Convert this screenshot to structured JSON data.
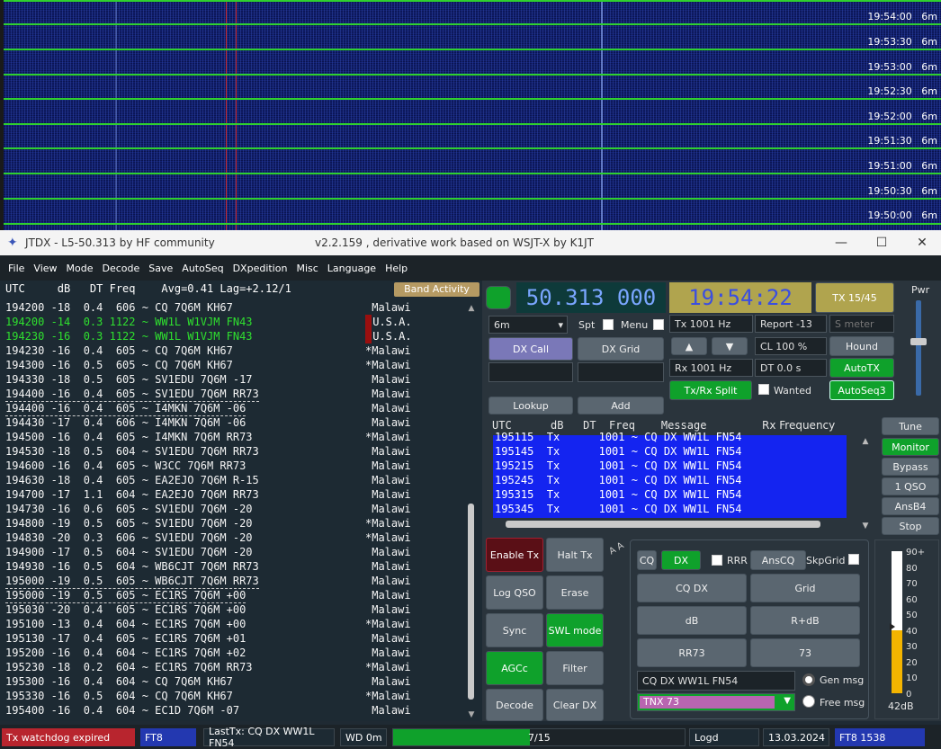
{
  "waterfall": {
    "times": [
      "19:54:00",
      "19:53:30",
      "19:53:00",
      "19:52:30",
      "19:52:00",
      "19:51:30",
      "19:51:00",
      "19:50:30",
      "19:50:00"
    ],
    "band": "6m"
  },
  "titlebar": {
    "title": "JTDX - L5-50.313  by HF community",
    "subtitle": "v2.2.159 , derivative work based on WSJT-X by K1JT",
    "minimize": "—",
    "maximize": "☐",
    "close": "✕"
  },
  "menu": [
    "File",
    "View",
    "Mode",
    "Decode",
    "Save",
    "AutoSeq",
    "DXpedition",
    "Misc",
    "Language",
    "Help"
  ],
  "decode_header": "UTC     dB   DT Freq    Avg=0.41 Lag=+2.12/1",
  "band_activity": "Band Activity",
  "decodes": [
    {
      "msg": "194200 -18  0.4  606 ~ CQ 7Q6M KH67",
      "country": " Malawi",
      "style": "white"
    },
    {
      "msg": "194200 -14  0.3 1122 ~ WW1L W1VJM FN43",
      "country": " U.S.A.",
      "style": "green"
    },
    {
      "msg": "194230 -16  0.3 1122 ~ WW1L W1VJM FN43",
      "country": " U.S.A.",
      "style": "green"
    },
    {
      "msg": "194230 -16  0.4  605 ~ CQ 7Q6M KH67",
      "country": "*Malawi",
      "style": "white"
    },
    {
      "msg": "194300 -16  0.5  605 ~ CQ 7Q6M KH67",
      "country": "*Malawi",
      "style": "white"
    },
    {
      "msg": "194330 -18  0.5  605 ~ SV1EDU 7Q6M -17",
      "country": " Malawi",
      "style": "white"
    },
    {
      "msg": "194400 -16  0.4  605 ~ SV1EDU 7Q6M RR73",
      "country": " Malawi",
      "style": "white"
    },
    {
      "msg": "194400 -16  0.4  605 ~ I4MKN 7Q6M -06",
      "country": " Malawi",
      "style": "white"
    },
    {
      "msg": "194430 -17  0.4  606 ~ I4MKN 7Q6M -06",
      "country": " Malawi",
      "style": "white"
    },
    {
      "msg": "194500 -16  0.4  605 ~ I4MKN 7Q6M RR73",
      "country": "*Malawi",
      "style": "white"
    },
    {
      "msg": "194530 -18  0.5  604 ~ SV1EDU 7Q6M RR73",
      "country": " Malawi",
      "style": "white"
    },
    {
      "msg": "194600 -16  0.4  605 ~ W3CC 7Q6M RR73",
      "country": " Malawi",
      "style": "white"
    },
    {
      "msg": "194630 -18  0.4  605 ~ EA2EJO 7Q6M R-15",
      "country": " Malawi",
      "style": "white"
    },
    {
      "msg": "194700 -17  1.1  604 ~ EA2EJO 7Q6M RR73",
      "country": " Malawi",
      "style": "white"
    },
    {
      "msg": "194730 -16  0.6  605 ~ SV1EDU 7Q6M -20",
      "country": " Malawi",
      "style": "white"
    },
    {
      "msg": "194800 -19  0.5  605 ~ SV1EDU 7Q6M -20",
      "country": "*Malawi",
      "style": "white"
    },
    {
      "msg": "194830 -20  0.3  606 ~ SV1EDU 7Q6M -20",
      "country": "*Malawi",
      "style": "white"
    },
    {
      "msg": "194900 -17  0.5  604 ~ SV1EDU 7Q6M -20",
      "country": " Malawi",
      "style": "white"
    },
    {
      "msg": "194930 -16  0.5  604 ~ WB6CJT 7Q6M RR73",
      "country": " Malawi",
      "style": "white"
    },
    {
      "msg": "195000 -19  0.5  605 ~ WB6CJT 7Q6M RR73",
      "country": " Malawi",
      "style": "white"
    },
    {
      "msg": "195000 -19  0.5  605 ~ EC1RS 7Q6M +00",
      "country": " Malawi",
      "style": "white"
    },
    {
      "msg": "195030 -20  0.4  605 ~ EC1RS 7Q6M +00",
      "country": " Malawi",
      "style": "white"
    },
    {
      "msg": "195100 -13  0.4  604 ~ EC1RS 7Q6M +00",
      "country": "*Malawi",
      "style": "white"
    },
    {
      "msg": "195130 -17  0.4  605 ~ EC1RS 7Q6M +01",
      "country": " Malawi",
      "style": "white"
    },
    {
      "msg": "195200 -16  0.4  604 ~ EC1RS 7Q6M +02",
      "country": " Malawi",
      "style": "white"
    },
    {
      "msg": "195230 -18  0.2  604 ~ EC1RS 7Q6M RR73",
      "country": "*Malawi",
      "style": "white"
    },
    {
      "msg": "195300 -16  0.4  604 ~ CQ 7Q6M KH67",
      "country": " Malawi",
      "style": "white"
    },
    {
      "msg": "195330 -16  0.5  604 ~ CQ 7Q6M KH67",
      "country": "*Malawi",
      "style": "white"
    },
    {
      "msg": "195400 -16  0.4  604 ~ EC1D 7Q6M -07",
      "country": " Malawi",
      "style": "white"
    }
  ],
  "control": {
    "frequency": "50.313 000",
    "time": "19:54:22",
    "tx_period": "TX 15/45",
    "pwr_label": "Pwr",
    "band": "6m",
    "spt_label": "Spt",
    "menu_label": "Menu",
    "tx_hz": "Tx  1001  Hz",
    "report": "Report -13",
    "s_meter": "S meter",
    "dx_call": "DX Call",
    "dx_grid": "DX Grid",
    "up": "▲",
    "down": "▼",
    "cl": "CL  100 %",
    "hound": "Hound",
    "rx_hz": "Rx  1001  Hz",
    "dt": "DT 0.0 s",
    "autotx": "AutoTX",
    "txrx_split": "Tx/Rx Split",
    "wanted": "Wanted",
    "autoseq": "AutoSeq3",
    "lookup": "Lookup",
    "add": "Add",
    "tx_header": "UTC      dB   DT  Freq    Message",
    "rx_freq_label": "Rx Frequency",
    "tune": "Tune",
    "monitor": "Monitor",
    "bypass": "Bypass",
    "one_qso": "1 QSO",
    "ansb4": "AnsB4",
    "stop": "Stop"
  },
  "tx_history": [
    "195115  Tx      1001 ~ CQ DX WW1L FN54",
    "195145  Tx      1001 ~ CQ DX WW1L FN54",
    "195215  Tx      1001 ~ CQ DX WW1L FN54",
    "195245  Tx      1001 ~ CQ DX WW1L FN54",
    "195315  Tx      1001 ~ CQ DX WW1L FN54",
    "195345  Tx      1001 ~ CQ DX WW1L FN54"
  ],
  "buttons": {
    "enable_tx": "Enable Tx",
    "halt_tx": "Halt Tx",
    "log_qso": "Log QSO",
    "erase": "Erase",
    "sync": "Sync",
    "swl_mode": "SWL mode",
    "agcc": "AGCc",
    "filter": "Filter",
    "decode": "Decode",
    "clear_dx": "Clear DX",
    "side_labels": "A A"
  },
  "txmsg": {
    "cq": "CQ",
    "dx": "DX",
    "rrr": "RRR",
    "anscq": "AnsCQ",
    "skpgrid": "SkpGrid",
    "cq_dx": "CQ DX",
    "grid": "Grid",
    "db": "dB",
    "r_db": "R+dB",
    "rr73": "RR73",
    "seventy_three": "73",
    "message": "CQ DX WW1L FN54",
    "free_message": "TNX 73",
    "gen_msg": "Gen msg",
    "free_msg": "Free msg"
  },
  "meter": {
    "ticks": [
      "90+",
      "80",
      "70",
      "60",
      "50",
      "40",
      "30",
      "20",
      "10",
      "0"
    ],
    "level_db": "42dB",
    "level_value": 42
  },
  "status": {
    "watchdog": "Tx watchdog expired",
    "mode": "FT8",
    "last_tx": "LastTx: CQ DX WW1L FN54",
    "wd": "WD 0m",
    "progress_text": "7/15",
    "progress_fraction": 0.47,
    "logd": "Logd",
    "date": "13.03.2024",
    "mode_freq": "FT8  1538"
  },
  "colors": {
    "waterfall_bg": "#0a1450",
    "grid_green": "#2fcf2f",
    "decode_green": "#2fe02f",
    "tx_list_bg": "#1424f0",
    "watchdog_red": "#b8252e",
    "accent_blue": "#2338b0",
    "meter_fill": "#f4b400"
  }
}
